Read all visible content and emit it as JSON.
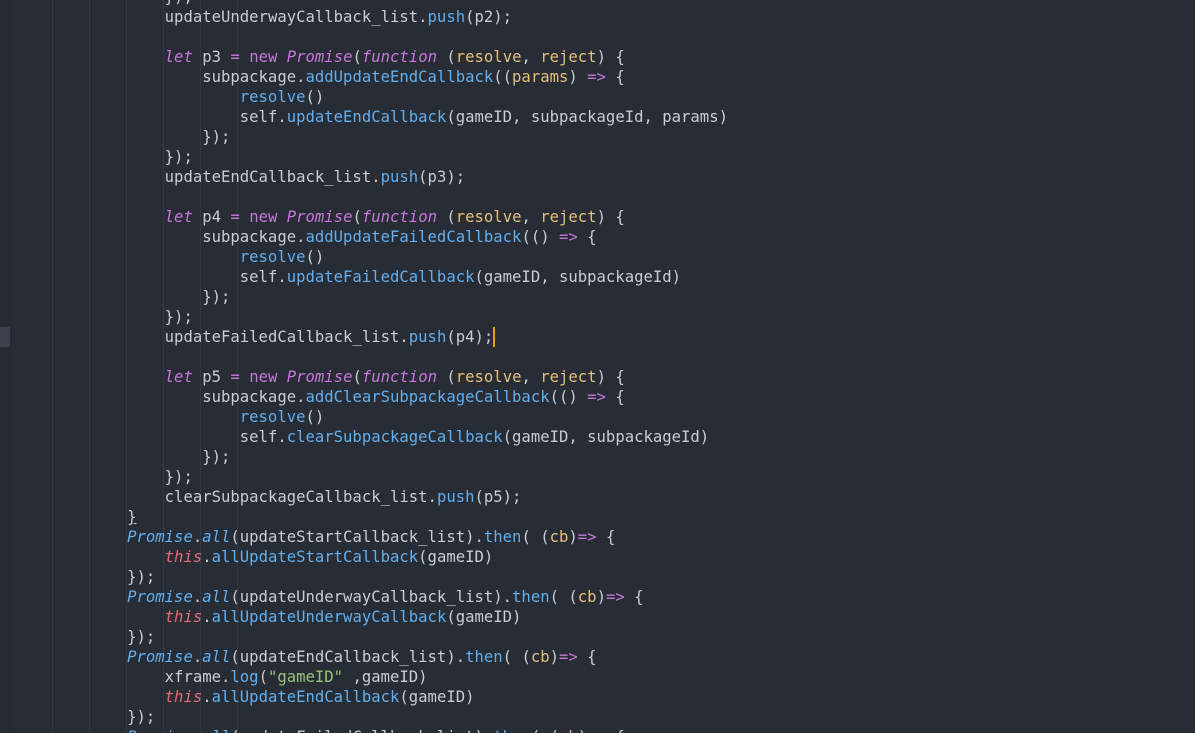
{
  "editor": {
    "lines": [
      {
        "indent": 3,
        "tokens": [
          {
            "t": "});",
            "k": "plain"
          }
        ]
      },
      {
        "indent": 3,
        "tokens": [
          {
            "t": "updateUnderwayCallback_list",
            "k": "plain"
          },
          {
            "t": ".",
            "k": "plain"
          },
          {
            "t": "push",
            "k": "method"
          },
          {
            "t": "(p2);",
            "k": "plain"
          }
        ]
      },
      {
        "indent": 0,
        "tokens": []
      },
      {
        "indent": 3,
        "tokens": [
          {
            "t": "let",
            "k": "keyword"
          },
          {
            "t": " p3 ",
            "k": "plain"
          },
          {
            "t": "=",
            "k": "op"
          },
          {
            "t": " ",
            "k": "plain"
          },
          {
            "t": "new",
            "k": "op"
          },
          {
            "t": " ",
            "k": "plain"
          },
          {
            "t": "Promise",
            "k": "class"
          },
          {
            "t": "(",
            "k": "plain"
          },
          {
            "t": "function",
            "k": "keyword"
          },
          {
            "t": " (",
            "k": "plain"
          },
          {
            "t": "resolve",
            "k": "param"
          },
          {
            "t": ", ",
            "k": "plain"
          },
          {
            "t": "reject",
            "k": "param"
          },
          {
            "t": ") {",
            "k": "plain"
          }
        ]
      },
      {
        "indent": 4,
        "tokens": [
          {
            "t": "subpackage",
            "k": "plain"
          },
          {
            "t": ".",
            "k": "plain"
          },
          {
            "t": "addUpdateEndCallback",
            "k": "method"
          },
          {
            "t": "((",
            "k": "plain"
          },
          {
            "t": "params",
            "k": "param"
          },
          {
            "t": ") ",
            "k": "plain"
          },
          {
            "t": "=>",
            "k": "op"
          },
          {
            "t": " {",
            "k": "plain"
          }
        ]
      },
      {
        "indent": 5,
        "tokens": [
          {
            "t": "resolve",
            "k": "method"
          },
          {
            "t": "()",
            "k": "plain"
          }
        ]
      },
      {
        "indent": 5,
        "tokens": [
          {
            "t": "self",
            "k": "plain"
          },
          {
            "t": ".",
            "k": "plain"
          },
          {
            "t": "updateEndCallback",
            "k": "method"
          },
          {
            "t": "(gameID, subpackageId, params)",
            "k": "plain"
          }
        ]
      },
      {
        "indent": 4,
        "tokens": [
          {
            "t": "});",
            "k": "plain"
          }
        ]
      },
      {
        "indent": 3,
        "tokens": [
          {
            "t": "});",
            "k": "plain"
          }
        ]
      },
      {
        "indent": 3,
        "tokens": [
          {
            "t": "updateEndCallback_list",
            "k": "plain"
          },
          {
            "t": ".",
            "k": "plain"
          },
          {
            "t": "push",
            "k": "method"
          },
          {
            "t": "(p3);",
            "k": "plain"
          }
        ]
      },
      {
        "indent": 0,
        "tokens": []
      },
      {
        "indent": 3,
        "tokens": [
          {
            "t": "let",
            "k": "keyword"
          },
          {
            "t": " p4 ",
            "k": "plain"
          },
          {
            "t": "=",
            "k": "op"
          },
          {
            "t": " ",
            "k": "plain"
          },
          {
            "t": "new",
            "k": "op"
          },
          {
            "t": " ",
            "k": "plain"
          },
          {
            "t": "Promise",
            "k": "class"
          },
          {
            "t": "(",
            "k": "plain"
          },
          {
            "t": "function",
            "k": "keyword"
          },
          {
            "t": " (",
            "k": "plain"
          },
          {
            "t": "resolve",
            "k": "param"
          },
          {
            "t": ", ",
            "k": "plain"
          },
          {
            "t": "reject",
            "k": "param"
          },
          {
            "t": ") {",
            "k": "plain"
          }
        ]
      },
      {
        "indent": 4,
        "tokens": [
          {
            "t": "subpackage",
            "k": "plain"
          },
          {
            "t": ".",
            "k": "plain"
          },
          {
            "t": "addUpdateFailedCallback",
            "k": "method"
          },
          {
            "t": "(() ",
            "k": "plain"
          },
          {
            "t": "=>",
            "k": "op"
          },
          {
            "t": " {",
            "k": "plain"
          }
        ]
      },
      {
        "indent": 5,
        "tokens": [
          {
            "t": "resolve",
            "k": "method"
          },
          {
            "t": "()",
            "k": "plain"
          }
        ]
      },
      {
        "indent": 5,
        "tokens": [
          {
            "t": "self",
            "k": "plain"
          },
          {
            "t": ".",
            "k": "plain"
          },
          {
            "t": "updateFailedCallback",
            "k": "method"
          },
          {
            "t": "(gameID, subpackageId)",
            "k": "plain"
          }
        ]
      },
      {
        "indent": 4,
        "tokens": [
          {
            "t": "});",
            "k": "plain"
          }
        ]
      },
      {
        "indent": 3,
        "tokens": [
          {
            "t": "});",
            "k": "plain"
          }
        ]
      },
      {
        "indent": 3,
        "cursor": true,
        "tokens": [
          {
            "t": "updateFailedCallback_list",
            "k": "plain"
          },
          {
            "t": ".",
            "k": "plain"
          },
          {
            "t": "push",
            "k": "method"
          },
          {
            "t": "(p4);",
            "k": "plain"
          }
        ]
      },
      {
        "indent": 0,
        "tokens": []
      },
      {
        "indent": 3,
        "tokens": [
          {
            "t": "let",
            "k": "keyword"
          },
          {
            "t": " p5 ",
            "k": "plain"
          },
          {
            "t": "=",
            "k": "op"
          },
          {
            "t": " ",
            "k": "plain"
          },
          {
            "t": "new",
            "k": "op"
          },
          {
            "t": " ",
            "k": "plain"
          },
          {
            "t": "Promise",
            "k": "class"
          },
          {
            "t": "(",
            "k": "plain"
          },
          {
            "t": "function",
            "k": "keyword"
          },
          {
            "t": " (",
            "k": "plain"
          },
          {
            "t": "resolve",
            "k": "param"
          },
          {
            "t": ", ",
            "k": "plain"
          },
          {
            "t": "reject",
            "k": "param"
          },
          {
            "t": ") {",
            "k": "plain"
          }
        ]
      },
      {
        "indent": 4,
        "tokens": [
          {
            "t": "subpackage",
            "k": "plain"
          },
          {
            "t": ".",
            "k": "plain"
          },
          {
            "t": "addClearSubpackageCallback",
            "k": "method"
          },
          {
            "t": "(() ",
            "k": "plain"
          },
          {
            "t": "=>",
            "k": "op"
          },
          {
            "t": " {",
            "k": "plain"
          }
        ]
      },
      {
        "indent": 5,
        "tokens": [
          {
            "t": "resolve",
            "k": "method"
          },
          {
            "t": "()",
            "k": "plain"
          }
        ]
      },
      {
        "indent": 5,
        "tokens": [
          {
            "t": "self",
            "k": "plain"
          },
          {
            "t": ".",
            "k": "plain"
          },
          {
            "t": "clearSubpackageCallback",
            "k": "method"
          },
          {
            "t": "(gameID, subpackageId)",
            "k": "plain"
          }
        ]
      },
      {
        "indent": 4,
        "tokens": [
          {
            "t": "});",
            "k": "plain"
          }
        ]
      },
      {
        "indent": 3,
        "tokens": [
          {
            "t": "});",
            "k": "plain"
          }
        ]
      },
      {
        "indent": 3,
        "tokens": [
          {
            "t": "clearSubpackageCallback_list",
            "k": "plain"
          },
          {
            "t": ".",
            "k": "plain"
          },
          {
            "t": "push",
            "k": "method"
          },
          {
            "t": "(p5);",
            "k": "plain"
          }
        ]
      },
      {
        "indent": 2,
        "tokens": [
          {
            "t": "}",
            "k": "underline"
          }
        ]
      },
      {
        "indent": 2,
        "tokens": [
          {
            "t": "Promise",
            "k": "static"
          },
          {
            "t": ".",
            "k": "plain"
          },
          {
            "t": "all",
            "k": "static"
          },
          {
            "t": "(updateStartCallback_list)",
            "k": "plain"
          },
          {
            "t": ".",
            "k": "plain"
          },
          {
            "t": "then",
            "k": "method"
          },
          {
            "t": "( (",
            "k": "plain"
          },
          {
            "t": "cb",
            "k": "param"
          },
          {
            "t": ")",
            "k": "plain"
          },
          {
            "t": "=>",
            "k": "op"
          },
          {
            "t": " {",
            "k": "plain"
          }
        ]
      },
      {
        "indent": 3,
        "tokens": [
          {
            "t": "this",
            "k": "this"
          },
          {
            "t": ".",
            "k": "plain"
          },
          {
            "t": "allUpdateStartCallback",
            "k": "method"
          },
          {
            "t": "(gameID)",
            "k": "plain"
          }
        ]
      },
      {
        "indent": 2,
        "tokens": [
          {
            "t": "});",
            "k": "plain"
          }
        ]
      },
      {
        "indent": 2,
        "tokens": [
          {
            "t": "Promise",
            "k": "static"
          },
          {
            "t": ".",
            "k": "plain"
          },
          {
            "t": "all",
            "k": "static"
          },
          {
            "t": "(updateUnderwayCallback_list)",
            "k": "plain"
          },
          {
            "t": ".",
            "k": "plain"
          },
          {
            "t": "then",
            "k": "method"
          },
          {
            "t": "( (",
            "k": "plain"
          },
          {
            "t": "cb",
            "k": "param"
          },
          {
            "t": ")",
            "k": "plain"
          },
          {
            "t": "=>",
            "k": "op"
          },
          {
            "t": " {",
            "k": "plain"
          }
        ]
      },
      {
        "indent": 3,
        "tokens": [
          {
            "t": "this",
            "k": "this"
          },
          {
            "t": ".",
            "k": "plain"
          },
          {
            "t": "allUpdateUnderwayCallback",
            "k": "method"
          },
          {
            "t": "(gameID)",
            "k": "plain"
          }
        ]
      },
      {
        "indent": 2,
        "tokens": [
          {
            "t": "});",
            "k": "plain"
          }
        ]
      },
      {
        "indent": 2,
        "tokens": [
          {
            "t": "Promise",
            "k": "static"
          },
          {
            "t": ".",
            "k": "plain"
          },
          {
            "t": "all",
            "k": "static"
          },
          {
            "t": "(updateEndCallback_list)",
            "k": "plain"
          },
          {
            "t": ".",
            "k": "plain"
          },
          {
            "t": "then",
            "k": "method"
          },
          {
            "t": "( (",
            "k": "plain"
          },
          {
            "t": "cb",
            "k": "param"
          },
          {
            "t": ")",
            "k": "plain"
          },
          {
            "t": "=>",
            "k": "op"
          },
          {
            "t": " {",
            "k": "plain"
          }
        ]
      },
      {
        "indent": 3,
        "tokens": [
          {
            "t": "xframe",
            "k": "plain"
          },
          {
            "t": ".",
            "k": "plain"
          },
          {
            "t": "log",
            "k": "method"
          },
          {
            "t": "(",
            "k": "plain"
          },
          {
            "t": "\"gameID\"",
            "k": "string"
          },
          {
            "t": " ,gameID)",
            "k": "plain"
          }
        ]
      },
      {
        "indent": 3,
        "tokens": [
          {
            "t": "this",
            "k": "this"
          },
          {
            "t": ".",
            "k": "plain"
          },
          {
            "t": "allUpdateEndCallback",
            "k": "method"
          },
          {
            "t": "(gameID)",
            "k": "plain"
          }
        ]
      },
      {
        "indent": 2,
        "tokens": [
          {
            "t": "});",
            "k": "plain"
          }
        ]
      },
      {
        "indent": 2,
        "tokens": [
          {
            "t": "Promise",
            "k": "static"
          },
          {
            "t": ".",
            "k": "plain"
          },
          {
            "t": "all",
            "k": "static"
          },
          {
            "t": "(updateFailedCallback_list)",
            "k": "plain"
          },
          {
            "t": ".",
            "k": "plain"
          },
          {
            "t": "then",
            "k": "method"
          },
          {
            "t": "( (",
            "k": "plain"
          },
          {
            "t": "cb",
            "k": "param"
          },
          {
            "t": ")",
            "k": "plain"
          },
          {
            "t": "=>",
            "k": "op"
          },
          {
            "t": " {",
            "k": "plain"
          }
        ]
      }
    ]
  }
}
